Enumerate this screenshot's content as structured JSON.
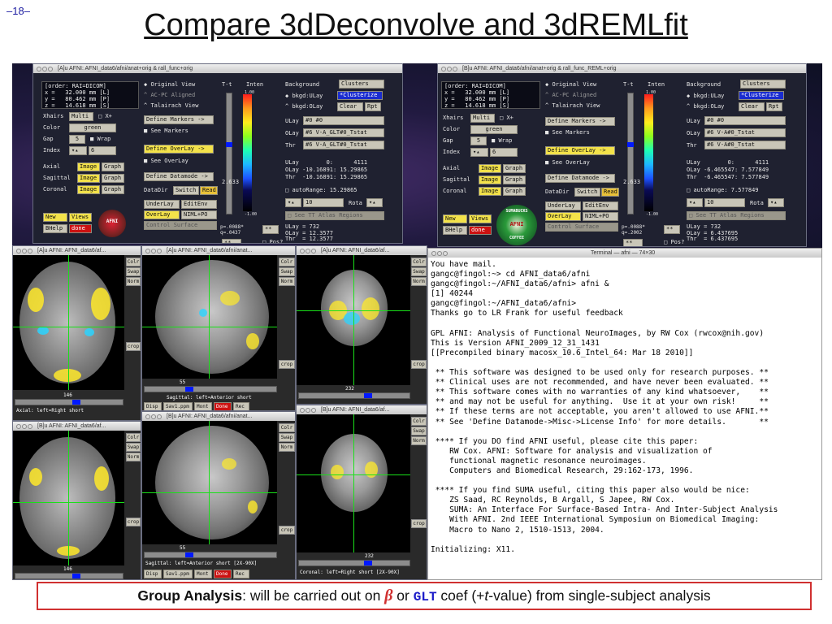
{
  "slide": {
    "number": "–18–",
    "title": "Compare 3dDeconvolve and 3dREMLfit"
  },
  "afni_left": {
    "title": "[A]u AFNI: AFNI_data6/afni/anat+orig & rall_func+orig",
    "coords": "[order: RAI=DICOM]\nx =   32.000 mm [L]\ny =   80.462 mm [P]\nz =   14.618 mm [S]",
    "original_view": "Original View",
    "acpc": "AC-PC Aligned",
    "talairach": "Talairach View",
    "xhairs": "Xhairs",
    "multi": "Multi",
    "xplus": "X+",
    "color": "Color",
    "green": "green",
    "gap": "Gap",
    "gap_val": "5",
    "wrap": "Wrap",
    "index": "Index",
    "index_val": "6",
    "axial": "Axial",
    "sagittal": "Sagittal",
    "coronal": "Coronal",
    "image": "Image",
    "graph": "Graph",
    "define_markers": "Define Markers ->",
    "see_markers": "See Markers",
    "define_overlay": "Define OverLay ->",
    "see_overlay": "See OverLay",
    "define_datamode": "Define Datamode ->",
    "datadir": "DataDir",
    "switch": "Switch",
    "read": "Read",
    "underlay": "UnderLay",
    "editenv": "EditEnv",
    "overlay": "OverLay",
    "niml": "NIML+PO",
    "control_surface": "Control Surface",
    "new": "New",
    "views": "Views",
    "bhelp": "BHelp",
    "done": "done",
    "t_t": "T-t",
    "inten": "Inten",
    "cbar_top": "1.00",
    "cbar_bot": "-1.00",
    "threshold": "2.633",
    "p_val": "p=.0088*\nq=.0437",
    "background": "Background",
    "clusters": "Clusters",
    "bkgd_ulay": "bkgd:ULay",
    "clusterize": "*Clusterize",
    "bkgd_olay": "bkgd:OLay",
    "clear": "Clear",
    "rpt": "Rpt",
    "ulay": "ULay",
    "ulay_val": "#0 #0",
    "olay": "OLay",
    "olay_val": "#6 V-A_GLT#0_Tstat",
    "thr": "Thr",
    "thr_val": "#6 V-A_GLT#0_Tstat",
    "info": "ULay        0:      4111\nOLay -10.16891: 15.29865\nThr  -10.16891: 15.29865",
    "autorange": "autoRange: 15.29865",
    "range_val": "10",
    "rota": "Rota",
    "atlas": "See TT Atlas Regions",
    "bottom_info": "ULay = 732\nOLay = 12.3577\nThr  = 12.3577",
    "pos": "Pos?",
    "star1": "**",
    "star2": "**"
  },
  "afni_right": {
    "title": "[B]u AFNI: AFNI_data6/afni/anat+orig & rall_func_REML+orig",
    "coords": "[order: RAI=DICOM]\nx =   32.000 mm [L]\ny =   80.462 mm [P]\nz =   14.618 mm [S]",
    "olay_val": "#6 V-A#0_Tstat",
    "thr_val": "#6 V-A#0_Tstat",
    "info": "ULay        0:      4111\nOLay -6.465547: 7.577849\nThr  -6.465547: 7.577849",
    "autorange": "autoRange: 7.577849",
    "p_val": "p=.0088*\nq=.2002",
    "bottom_info": "ULay = 732\nOLay = 6.437695\nThr  = 6.437695"
  },
  "image_windows": {
    "a_axial_title": "[A]u AFNI: AFNI_data6/af...",
    "a_sag_title": "[A]u AFNI: AFNI_data6/afni/anat...",
    "a_cor_title": "[A]u AFNI: AFNI_data6/af...",
    "b_axial_title": "[B]u AFNI: AFNI_data6/af...",
    "b_sag_title": "[B]u AFNI: AFNI_data6/afni/anat...",
    "b_cor_title": "[B]u AFNI: AFNI_data6/af...",
    "axial_num": "146",
    "axial_label": "Axial: left=Right short",
    "sag_num": "55",
    "sag_label": "Sagittal: left=Anterior short",
    "sag_label_b": "Sagittal: left=Anterior short [2X-90X]",
    "cor_num": "232",
    "cor_label": "Coronal: left=Right short [2X-90X]",
    "side_btns": [
      "Colr",
      "Swap",
      "Norm"
    ],
    "crop": "crop",
    "disp": "Disp",
    "save": "Sav1.ppm",
    "mont": "Mont",
    "done": "Done",
    "rec": "Rec",
    "s_btn": "S"
  },
  "terminal": {
    "title": "Terminal — afni — 74×30",
    "lines": [
      "You have mail.",
      "gangc@fingol:~> cd AFNI_data6/afni",
      "gangc@fingol:~/AFNI_data6/afni> afni &",
      "[1] 40244",
      "gangc@fingol:~/AFNI_data6/afni>",
      "Thanks go to LR Frank for useful feedback",
      "",
      "GPL AFNI: Analysis of Functional NeuroImages, by RW Cox (rwcox@nih.gov)",
      "This is Version AFNI_2009_12_31_1431",
      "[[Precompiled binary macosx_10.6_Intel_64: Mar 18 2010]]",
      "",
      " ** This software was designed to be used only for research purposes. **",
      " ** Clinical uses are not recommended, and have never been evaluated. **",
      " ** This software comes with no warranties of any kind whatsoever,    **",
      " ** and may not be useful for anything.  Use it at your own risk!     **",
      " ** If these terms are not acceptable, you aren't allowed to use AFNI.**",
      " ** See 'Define Datamode->Misc->License Info' for more details.       **",
      "",
      " **** If you DO find AFNI useful, please cite this paper:",
      "    RW Cox. AFNI: Software for analysis and visualization of",
      "    functional magnetic resonance neuroimages.",
      "    Computers and Biomedical Research, 29:162-173, 1996.",
      "",
      " **** If you find SUMA useful, citing this paper also would be nice:",
      "    ZS Saad, RC Reynolds, B Argall, S Japee, RW Cox.",
      "    SUMA: An Interface For Surface-Based Intra- And Inter-Subject Analysis",
      "    With AFNI. 2nd IEEE International Symposium on Biomedical Imaging:",
      "    Macro to Nano 2, 1510-1513, 2004.",
      "",
      "Initializing: X11."
    ]
  },
  "caption": {
    "bold": "Group Analysis",
    "part1": ": will be carried out on ",
    "beta": "β",
    "part2": " or ",
    "glt": "GLT",
    "part3": " coef (+",
    "t": "t",
    "part4": "-value) from single-subject analysis"
  },
  "colors": {
    "title_text": "#111111",
    "slide_number": "#1a1aa0",
    "caption_border": "#d03030",
    "crosshair": "#19e019",
    "button_yellow": "#f3e24a",
    "done_red": "#cc1111"
  },
  "logos": {
    "left": "AFNI",
    "right_top": "SUMABUCKS",
    "right_mid": "AFNI",
    "right_bot": "COFFEE"
  }
}
